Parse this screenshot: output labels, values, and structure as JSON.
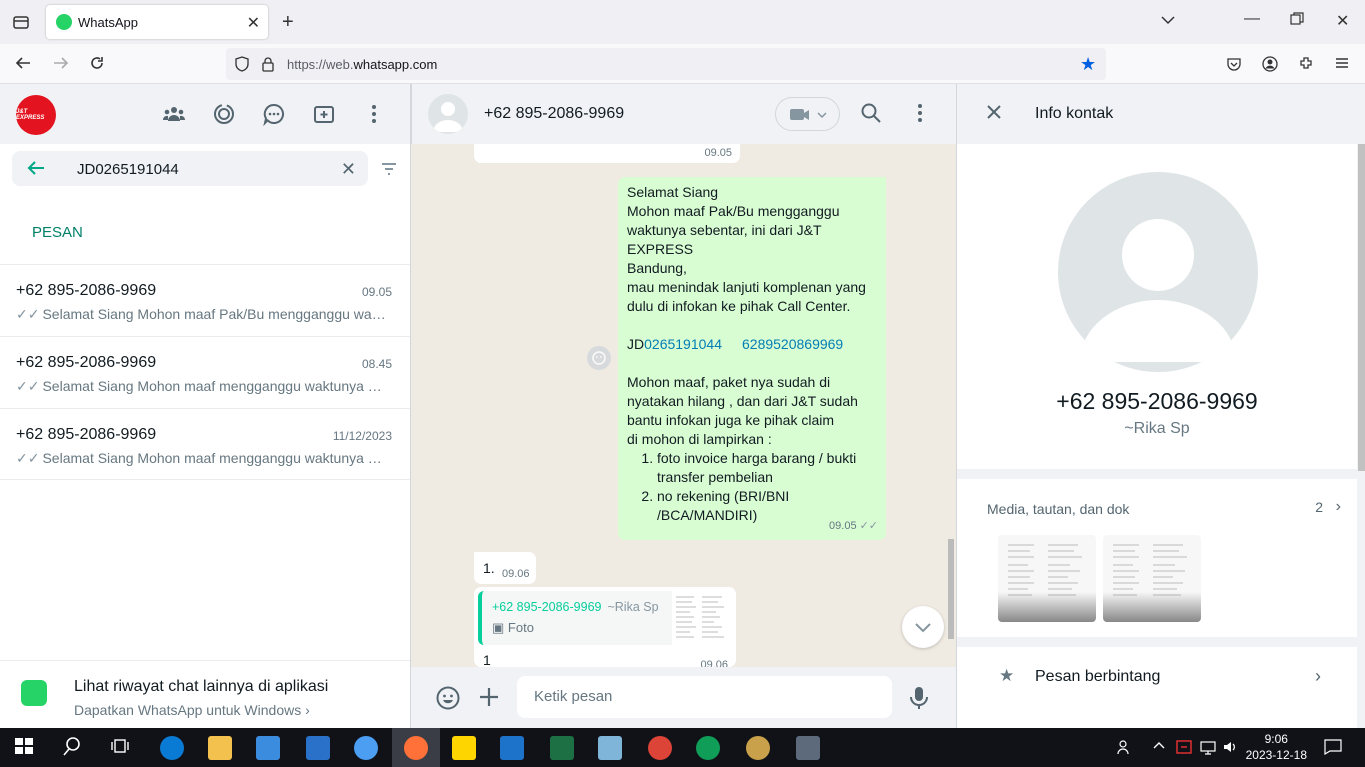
{
  "browser": {
    "tab_title": "WhatsApp",
    "url_prefix": "https://web.",
    "url_domain": "whatsapp.com"
  },
  "left": {
    "logo_text": "J&T EXPRESS",
    "search_value": "JD0265191044",
    "section_label": "PESAN",
    "chats": [
      {
        "name": "+62 895-2086-9969",
        "time": "09.05",
        "preview": "Selamat Siang Mohon maaf Pak/Bu mengganggu waktunya sebentar, ini dari J&T EXPRESS Bandung,"
      },
      {
        "name": "+62 895-2086-9969",
        "time": "08.45",
        "preview": "Selamat Siang Mohon maaf mengganggu waktunya sebentar, ini dari J&T EXPRESS Bandung,"
      },
      {
        "name": "+62 895-2086-9969",
        "time": "11/12/2023",
        "preview": "Selamat Siang Mohon maaf mengganggu waktunya sebentar, ini dari J&T EXPRESS Bandung,"
      }
    ],
    "promo_title": "Lihat riwayat chat lainnya di aplikasi",
    "promo_sub": "Dapatkan WhatsApp untuk Windows"
  },
  "chat": {
    "contact": "+62 895-2086-9969",
    "top_time": "09.05",
    "out_message": {
      "l1": "Selamat Siang",
      "l2": "Mohon maaf Pak/Bu mengganggu",
      "l3": "waktunya sebentar, ini dari J&T EXPRESS",
      "l4": "Bandung,",
      "l5": "mau menindak lanjuti komplenan yang",
      "l6": "dulu di infokan ke pihak Call Center.",
      "jd_prefix": "JD",
      "jd_link": "0265191044",
      "phone_link": "6289520869969",
      "p1": "Mohon maaf, paket nya sudah di",
      "p2": "nyatakan hilang , dan dari J&T  sudah",
      "p3": "bantu infokan juga ke pihak claim",
      "p4": "di mohon di lampirkan :",
      "items": [
        "foto invoice harga barang / bukti transfer pembelian",
        "no rekening (BRI/BNI /BCA/MANDIRI)"
      ],
      "time": "09.05"
    },
    "in1": {
      "text": "1.",
      "time": "09.06"
    },
    "in2": {
      "quote_name": "+62 895-2086-9969",
      "quote_alias": "~Rika Sp",
      "quote_type": "Foto",
      "text": "1",
      "time": "09.06"
    },
    "compose_placeholder": "Ketik pesan"
  },
  "info": {
    "title": "Info kontak",
    "number": "+62 895-2086-9969",
    "alias": "~Rika Sp",
    "media_label": "Media, tautan, dan dok",
    "media_count": "2",
    "starred_label": "Pesan berbintang"
  },
  "taskbar": {
    "time": "9:06",
    "date": "2023-12-18"
  },
  "colors": {
    "accent": "#00a884",
    "outgoing_bubble": "#d9fdd3",
    "link": "#027eb5",
    "jt_red": "#e3141f"
  }
}
